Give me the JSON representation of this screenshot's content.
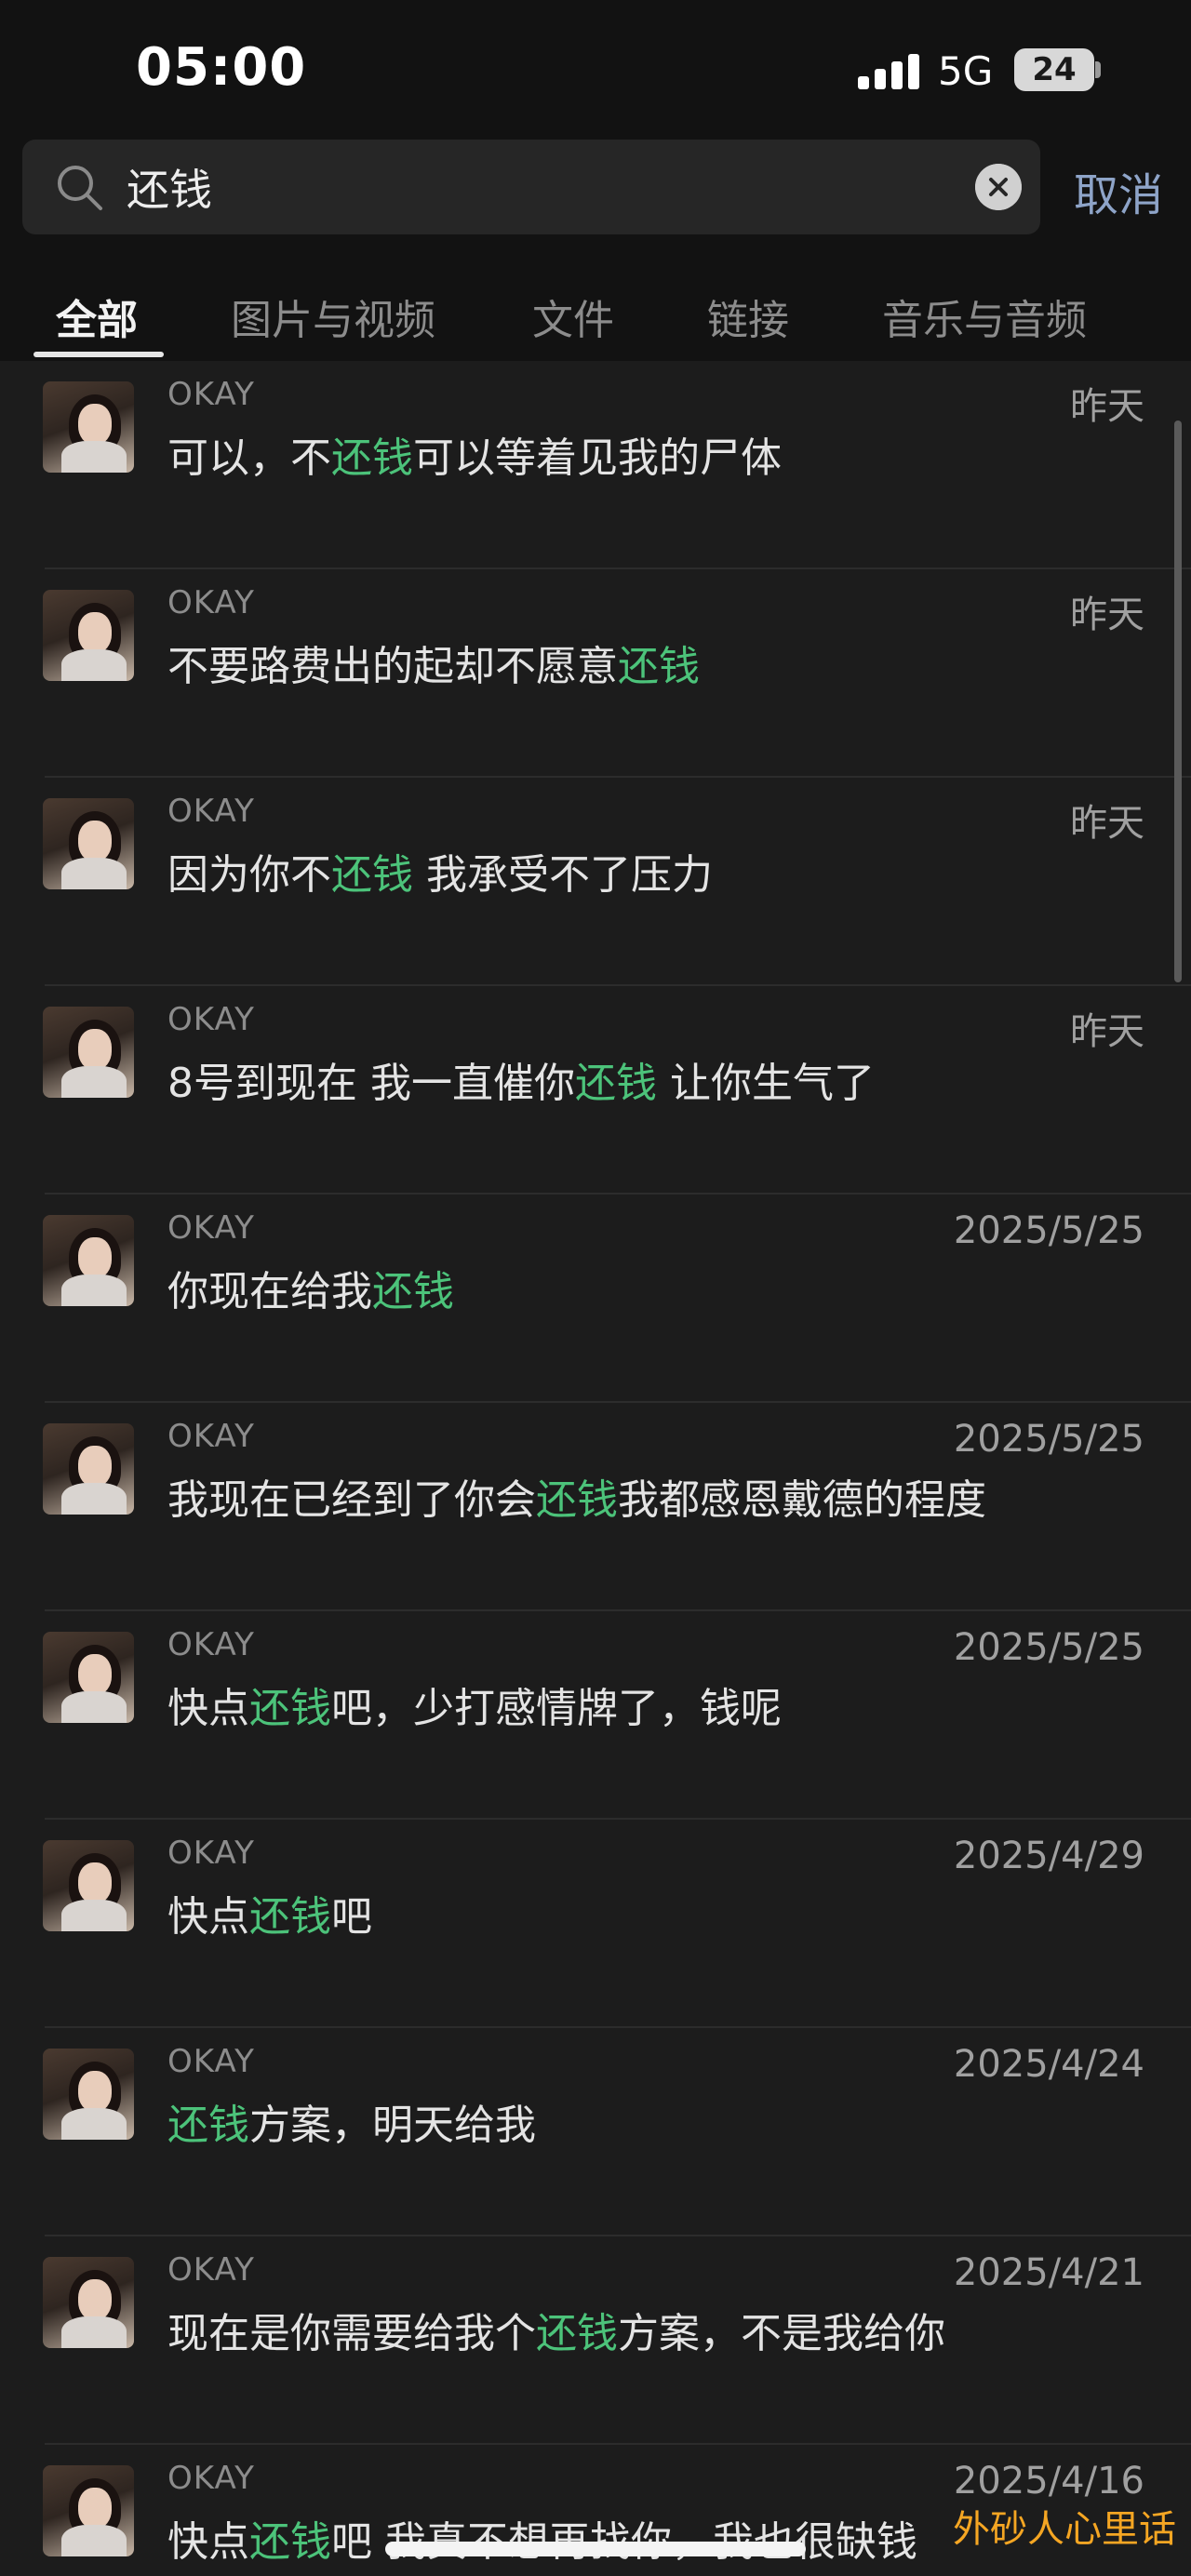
{
  "status_bar": {
    "time": "05:00",
    "network": "5G",
    "battery": "24"
  },
  "search": {
    "value": "还钱",
    "cancel_label": "取消"
  },
  "tabs": [
    "全部",
    "图片与视频",
    "文件",
    "链接",
    "音乐与音频"
  ],
  "results": [
    {
      "sender": "OKAY",
      "date": "昨天",
      "before": "可以，不",
      "keyword": "还钱",
      "after": "可以等着见我的尸体"
    },
    {
      "sender": "OKAY",
      "date": "昨天",
      "before": "不要路费出的起却不愿意",
      "keyword": "还钱",
      "after": ""
    },
    {
      "sender": "OKAY",
      "date": "昨天",
      "before": "因为你不",
      "keyword": "还钱",
      "after": " 我承受不了压力"
    },
    {
      "sender": "OKAY",
      "date": "昨天",
      "before": "8号到现在 我一直催你",
      "keyword": "还钱",
      "after": " 让你生气了"
    },
    {
      "sender": "OKAY",
      "date": "2025/5/25",
      "before": "你现在给我",
      "keyword": "还钱",
      "after": ""
    },
    {
      "sender": "OKAY",
      "date": "2025/5/25",
      "before": "我现在已经到了你会",
      "keyword": "还钱",
      "after": "我都感恩戴德的程度"
    },
    {
      "sender": "OKAY",
      "date": "2025/5/25",
      "before": "快点",
      "keyword": "还钱",
      "after": "吧，少打感情牌了，钱呢"
    },
    {
      "sender": "OKAY",
      "date": "2025/4/29",
      "before": "快点",
      "keyword": "还钱",
      "after": "吧"
    },
    {
      "sender": "OKAY",
      "date": "2025/4/24",
      "before": "",
      "keyword": "还钱",
      "after": "方案，明天给我"
    },
    {
      "sender": "OKAY",
      "date": "2025/4/21",
      "before": "现在是你需要给我个",
      "keyword": "还钱",
      "after": "方案，不是我给你"
    },
    {
      "sender": "OKAY",
      "date": "2025/4/16",
      "before": "快点",
      "keyword": "还钱",
      "after": "吧 我真不想再找你，我也很缺钱"
    }
  ],
  "watermark": "外砂人心里话",
  "colors": {
    "highlight": "#4cc37a",
    "cancel": "#8ea4c8",
    "watermark": "#f5a623"
  }
}
